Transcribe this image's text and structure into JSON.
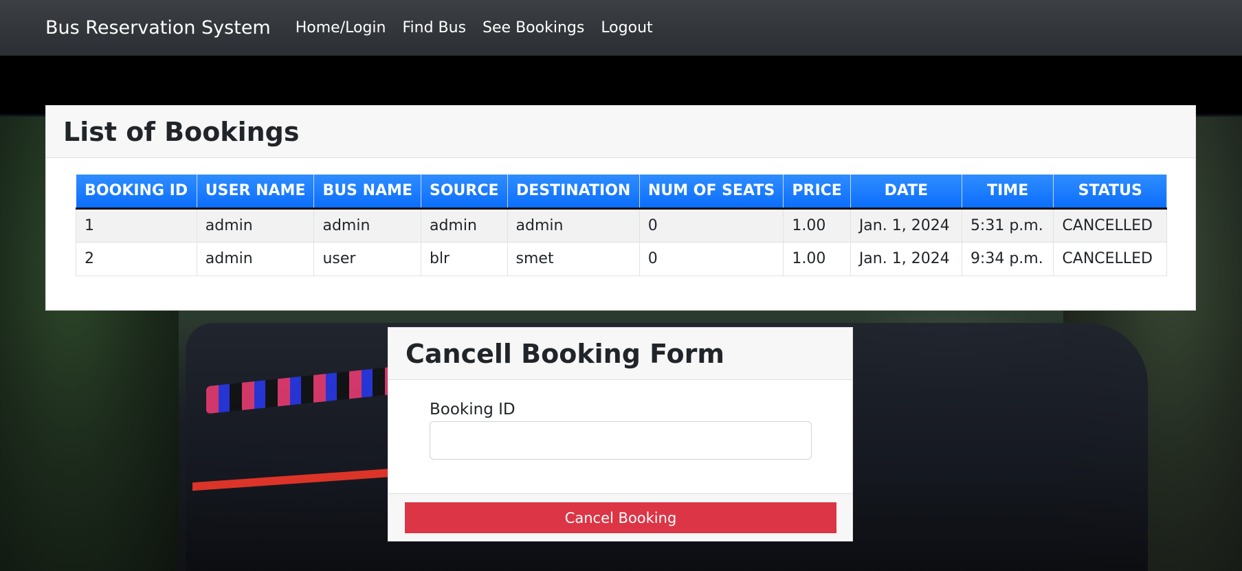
{
  "navbar": {
    "brand": "Bus Reservation System",
    "links": [
      "Home/Login",
      "Find Bus",
      "See Bookings",
      "Logout"
    ]
  },
  "bookings": {
    "title": "List of Bookings",
    "columns": [
      "BOOKING ID",
      "USER NAME",
      "BUS NAME",
      "SOURCE",
      "DESTINATION",
      "NUM OF SEATS",
      "PRICE",
      "DATE",
      "TIME",
      "STATUS"
    ],
    "rows": [
      [
        "1",
        "admin",
        "admin",
        "admin",
        "admin",
        "0",
        "1.00",
        "Jan. 1, 2024",
        "5:31 p.m.",
        "CANCELLED"
      ],
      [
        "2",
        "admin",
        "user",
        "blr",
        "smet",
        "0",
        "1.00",
        "Jan. 1, 2024",
        "9:34 p.m.",
        "CANCELLED"
      ]
    ]
  },
  "cancel_form": {
    "title": "Cancell Booking Form",
    "booking_id_label": "Booking ID",
    "booking_id_value": "",
    "submit_label": "Cancel Booking"
  },
  "colors": {
    "navbar": "#343a40",
    "table_header": "#0d6efd",
    "danger": "#dc3545"
  }
}
